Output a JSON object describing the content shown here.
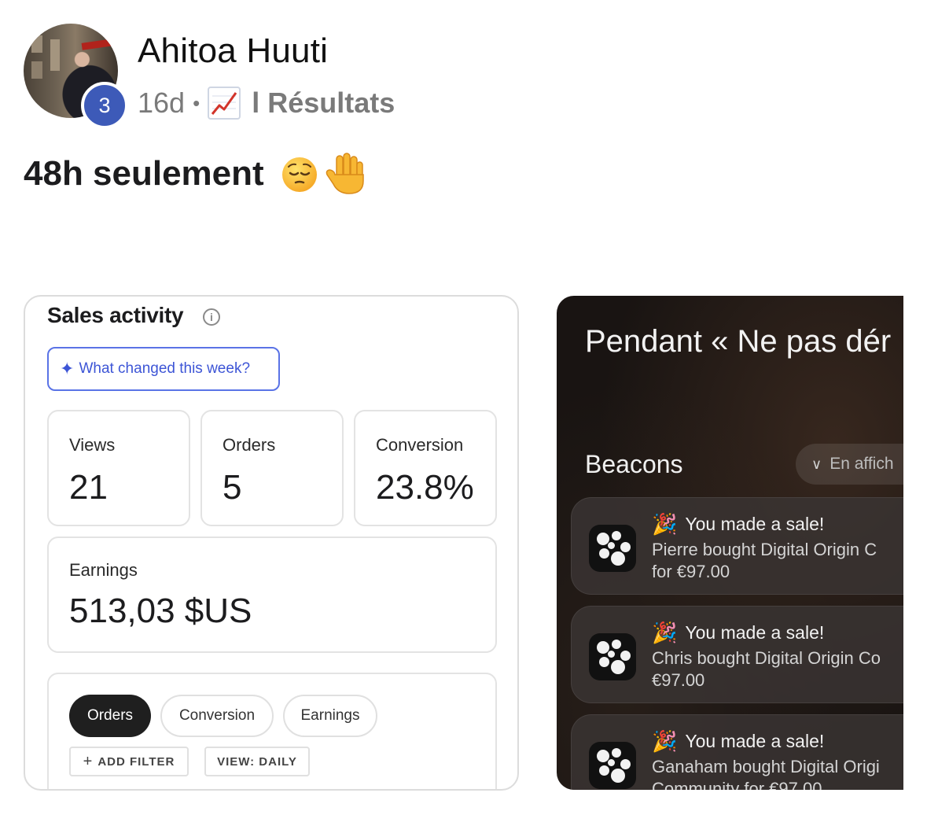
{
  "post": {
    "author": "Ahitoa Huuti",
    "badge_count": "3",
    "age": "16d",
    "separator": "•",
    "category": "l Résultats",
    "category_icon": "chart-increasing-icon",
    "text": "48h seulement",
    "emojis": [
      "pensive-face-icon",
      "raised-hand-icon"
    ]
  },
  "sales": {
    "title": "Sales activity",
    "info_icon": "i",
    "ai_button": "What changed this week?",
    "stats": {
      "views_label": "Views",
      "views_value": "21",
      "orders_label": "Orders",
      "orders_value": "5",
      "conversion_label": "Conversion",
      "conversion_value": "23.8%",
      "earnings_label": "Earnings",
      "earnings_value": "513,03 $US"
    },
    "tabs": [
      "Orders",
      "Conversion",
      "Earnings"
    ],
    "add_filter": "ADD FILTER",
    "view": "VIEW: DAILY"
  },
  "notifications": {
    "title": "Pendant « Ne pas dér",
    "app": "Beacons",
    "dropdown": "En affich",
    "items": [
      {
        "title": "You made a sale!",
        "body": "Pierre bought Digital Origin C\nfor €97.00"
      },
      {
        "title": "You made a sale!",
        "body": "Chris bought Digital Origin Co\n€97.00"
      },
      {
        "title": "You made a sale!",
        "body": "Ganaham bought Digital Origi\nCommunity for €97.00"
      }
    ]
  },
  "colors": {
    "badge": "#3d5ab8",
    "accent_blue": "#3d55d6",
    "dark_bg": "#191412"
  }
}
